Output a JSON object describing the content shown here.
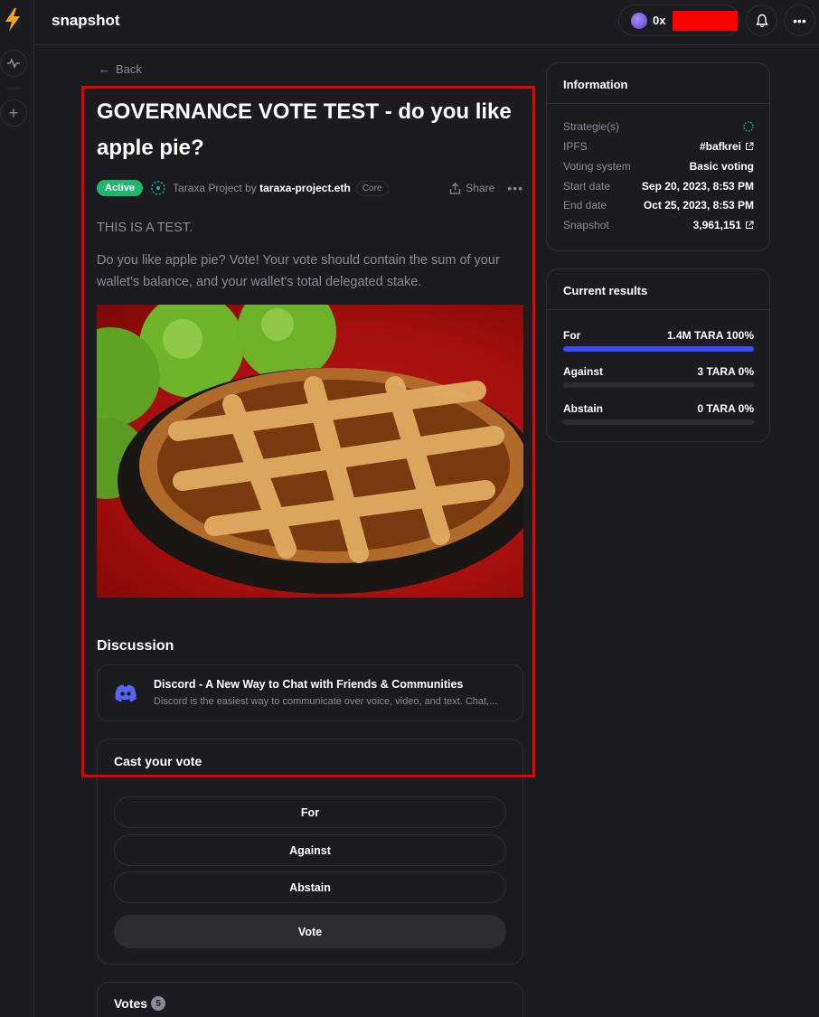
{
  "app": {
    "name": "snapshot"
  },
  "header": {
    "account_prefix": "0x"
  },
  "nav": {
    "back_label": "Back"
  },
  "proposal": {
    "title": "GOVERNANCE VOTE TEST - do you like apple pie?",
    "state": "Active",
    "space_name": "Taraxa Project",
    "by_label": "by",
    "author": "taraxa-project.eth",
    "author_badge": "Core",
    "share_label": "Share",
    "body_line1": "THIS IS A TEST.",
    "body_line2": "Do you like apple pie? Vote! Your vote should contain the sum of your wallet's balance, and your wallet's total delegated stake."
  },
  "discussion": {
    "heading": "Discussion",
    "link_title": "Discord - A New Way to Chat with Friends & Communities",
    "link_description": "Discord is the easiest way to communicate over voice, video, and text. Chat,..."
  },
  "cast_vote": {
    "heading": "Cast your vote",
    "choices": [
      "For",
      "Against",
      "Abstain"
    ],
    "submit_label": "Vote"
  },
  "votes": {
    "heading": "Votes",
    "count": "5"
  },
  "information": {
    "heading": "Information",
    "rows": [
      {
        "label": "Strategie(s)",
        "value": ""
      },
      {
        "label": "IPFS",
        "value": "#bafkrei"
      },
      {
        "label": "Voting system",
        "value": "Basic voting"
      },
      {
        "label": "Start date",
        "value": "Sep 20, 2023, 8:53 PM"
      },
      {
        "label": "End date",
        "value": "Oct 25, 2023, 8:53 PM"
      },
      {
        "label": "Snapshot",
        "value": "3,961,151"
      }
    ]
  },
  "results": {
    "heading": "Current results",
    "rows": [
      {
        "label": "For",
        "amount": "1.4M TARA",
        "percent": "100%",
        "fraction": 1.0
      },
      {
        "label": "Against",
        "amount": "3 TARA",
        "percent": "0%",
        "fraction": 0.0
      },
      {
        "label": "Abstain",
        "amount": "0 TARA",
        "percent": "0%",
        "fraction": 0.0
      }
    ]
  },
  "colors": {
    "accent": "#384aff",
    "active": "#21b66f",
    "highlight": "#e60000",
    "discord": "#5865f2"
  }
}
